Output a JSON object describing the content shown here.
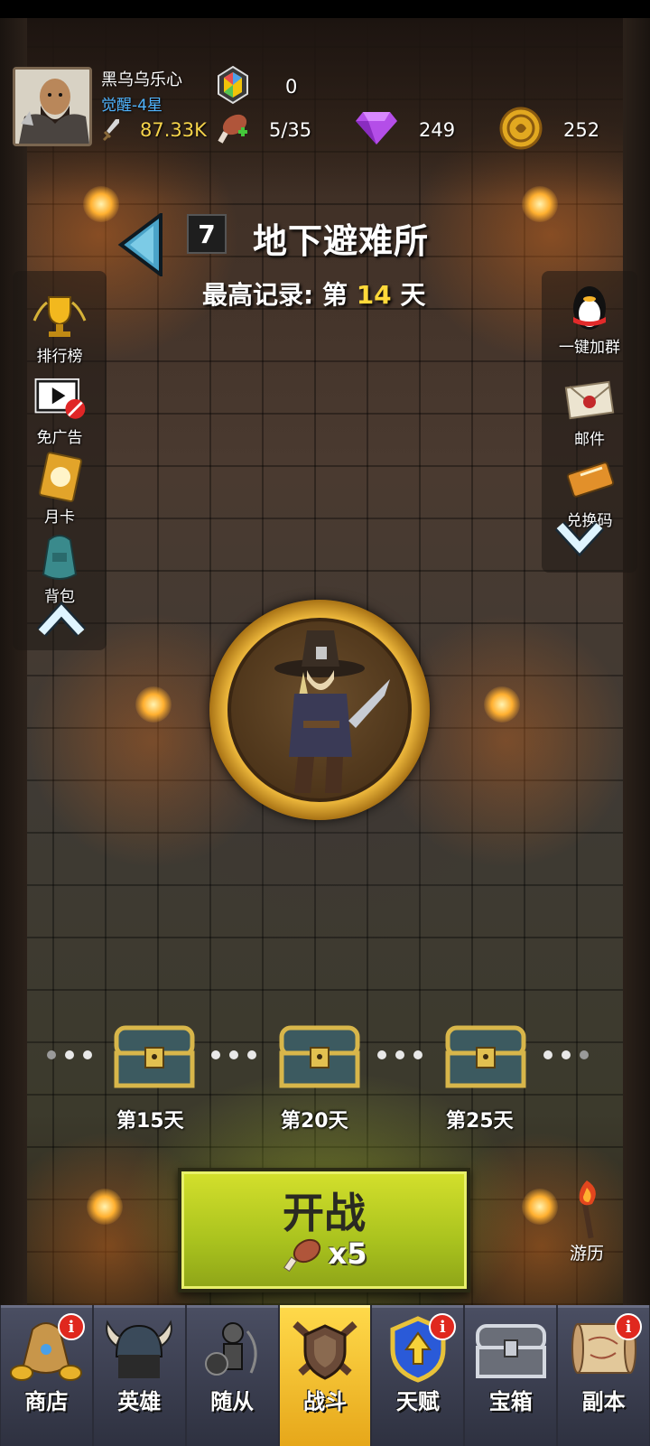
{
  "player": {
    "name": "黑乌乌乐心",
    "rank": "觉醒-4星",
    "power": "87.33K"
  },
  "resources": {
    "gem": "0",
    "stamina": "5/35",
    "diamond": "249",
    "coin": "252"
  },
  "stage": {
    "number": "7",
    "name": "地下避难所",
    "record_prefix": "最高记录: 第",
    "record_day": "14",
    "record_suffix": "天"
  },
  "left_menu": [
    {
      "label": "排行榜",
      "icon": "trophy-icon"
    },
    {
      "label": "免广告",
      "icon": "no-ads-icon"
    },
    {
      "label": "月卡",
      "icon": "monthly-card-icon"
    },
    {
      "label": "背包",
      "icon": "backpack-icon"
    }
  ],
  "right_menu": [
    {
      "label": "一键加群",
      "icon": "qq-penguin-icon"
    },
    {
      "label": "邮件",
      "icon": "mail-icon"
    },
    {
      "label": "兑换码",
      "icon": "ticket-icon"
    }
  ],
  "milestones": [
    {
      "label": "第15天"
    },
    {
      "label": "第20天"
    },
    {
      "label": "第25天"
    }
  ],
  "start": {
    "label": "开战",
    "cost": "x5"
  },
  "travel": {
    "label": "游历"
  },
  "nav": [
    {
      "label": "商店",
      "badge": "i",
      "active": false
    },
    {
      "label": "英雄",
      "badge": "",
      "active": false
    },
    {
      "label": "随从",
      "badge": "",
      "active": false
    },
    {
      "label": "战斗",
      "badge": "",
      "active": true
    },
    {
      "label": "天赋",
      "badge": "i",
      "active": false
    },
    {
      "label": "宝箱",
      "badge": "",
      "active": false
    },
    {
      "label": "副本",
      "badge": "i",
      "active": false
    }
  ],
  "colors": {
    "accent_yellow": "#ffd93a",
    "start_green": "#b4cc22",
    "rank_blue": "#4fb4ff",
    "nav_active": "#f2c034"
  }
}
